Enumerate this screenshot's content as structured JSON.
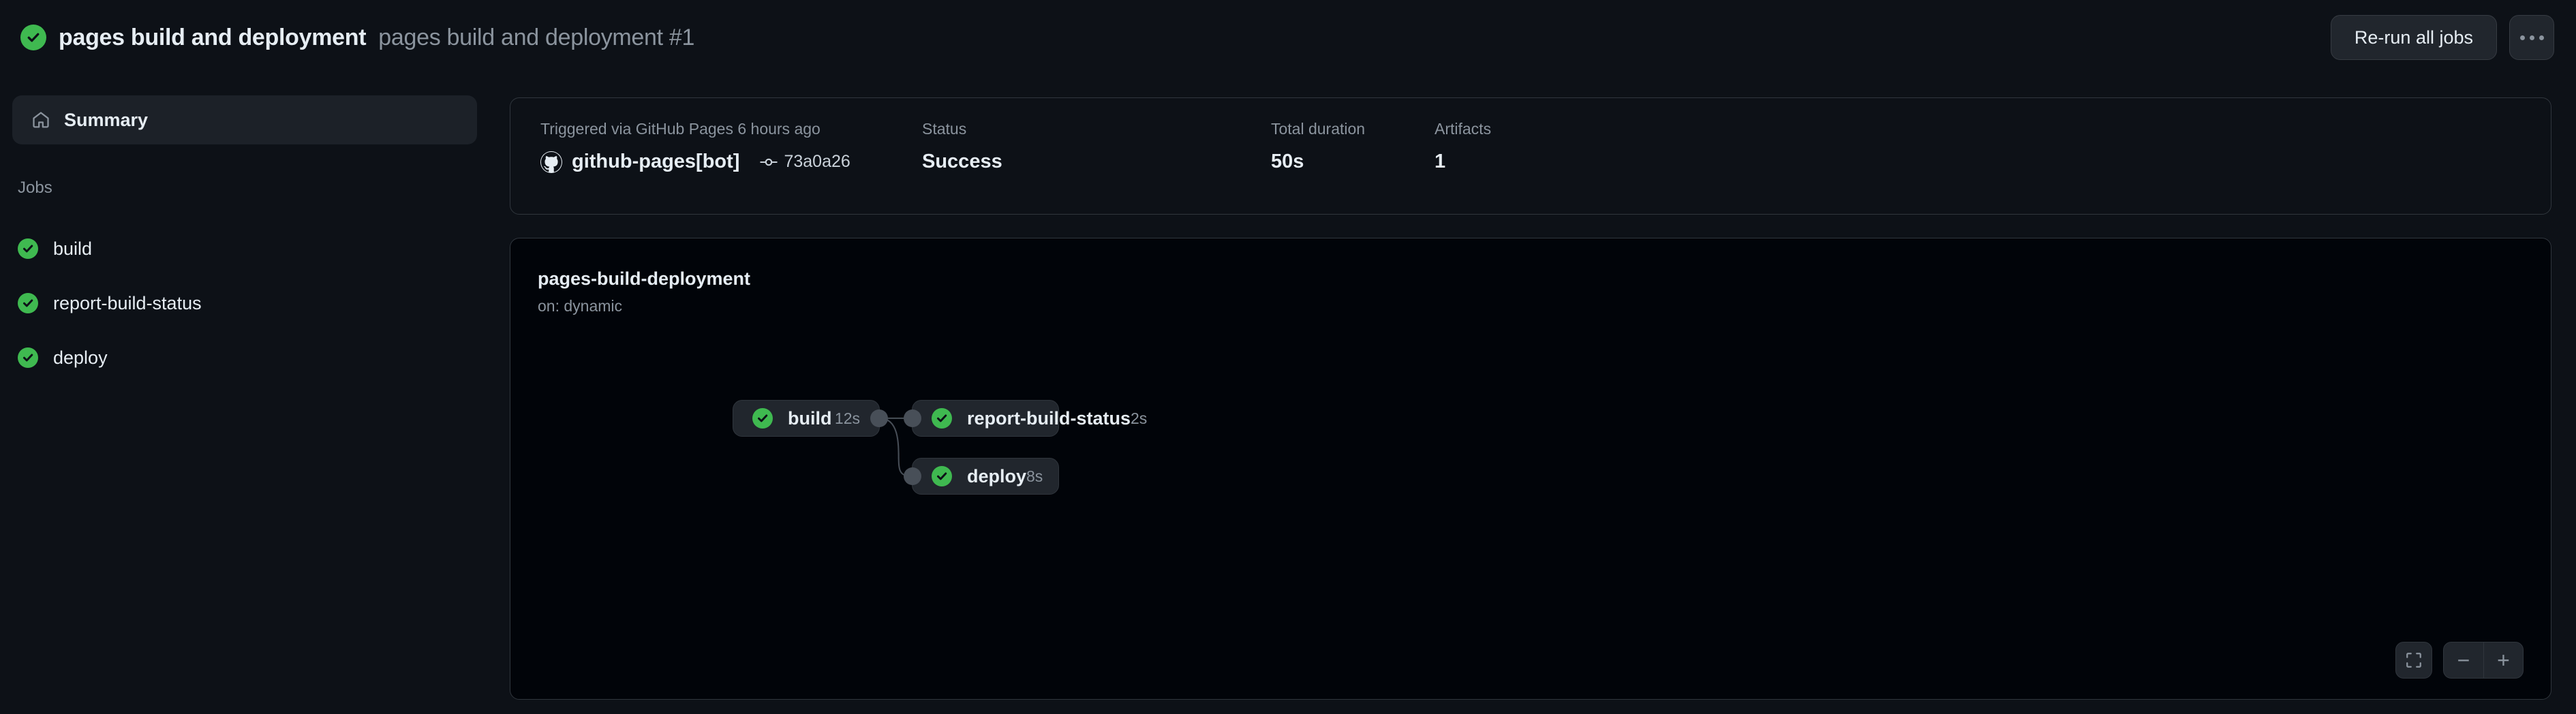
{
  "header": {
    "status_icon": "check-circle-icon",
    "workflow_name": "pages build and deployment",
    "run_name": "pages build and deployment #1",
    "rerun_button": "Re-run all jobs",
    "overflow_button": "kebab-icon",
    "accent_green": "#3fb950"
  },
  "sidebar": {
    "summary": {
      "icon": "home-icon",
      "label": "Summary"
    },
    "jobs_heading": "Jobs",
    "jobs": [
      {
        "label": "build",
        "status": "success"
      },
      {
        "label": "report-build-status",
        "status": "success"
      },
      {
        "label": "deploy",
        "status": "success"
      }
    ]
  },
  "summary_card": {
    "trigger": {
      "label": "Triggered via GitHub Pages 6 hours ago",
      "actor": "github-pages[bot]",
      "commit_sha": "73a0a26",
      "commit_icon": "git-commit-icon",
      "avatar_icon": "github-avatar-icon"
    },
    "status": {
      "label": "Status",
      "value": "Success"
    },
    "duration": {
      "label": "Total duration",
      "value": "50s"
    },
    "artifacts": {
      "label": "Artifacts",
      "value": "1"
    }
  },
  "graph": {
    "title": "pages-build-deployment",
    "subtitle": "on: dynamic",
    "nodes": [
      {
        "id": "build",
        "label": "build",
        "duration": "12s",
        "status": "success"
      },
      {
        "id": "report",
        "label": "report-build-status",
        "duration": "2s",
        "status": "success"
      },
      {
        "id": "deploy",
        "label": "deploy",
        "duration": "8s",
        "status": "success"
      }
    ],
    "edges": [
      {
        "from": "build",
        "to": "report"
      },
      {
        "from": "build",
        "to": "deploy"
      }
    ],
    "controls": {
      "fit_view": "fit-screen-icon",
      "zoom_out": "−",
      "zoom_in": "+"
    }
  }
}
